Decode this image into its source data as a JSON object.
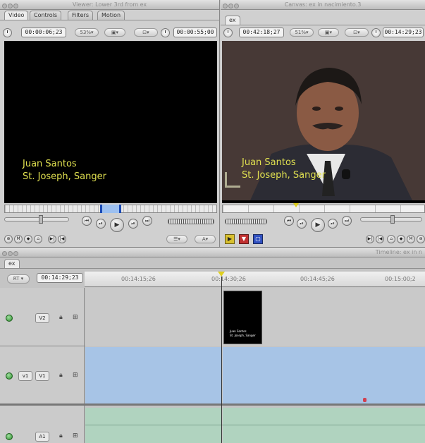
{
  "viewer": {
    "title": "Viewer: Lower 3rd from ex",
    "tabs": [
      "Video",
      "Controls",
      "Filters",
      "Motion"
    ],
    "timecode_left": "00:00:06;23",
    "zoom": "53%",
    "timecode_right": "00:00:55;00",
    "overlay_line1": "Juan Santos",
    "overlay_line2": "St. Joseph, Sanger"
  },
  "canvas": {
    "title": "Canvas: ex in nacimiento.3",
    "tab": "ex",
    "timecode_left": "00:42:18;27",
    "zoom": "51%",
    "timecode_right": "00:14:29;23",
    "overlay_line1": "Juan Santos",
    "overlay_line2": "St. Joseph, Sanger"
  },
  "timeline": {
    "title": "Timeline: ex in n",
    "tab": "ex",
    "rt_label": "RT",
    "current_timecode": "00:14:29;23",
    "ruler_ticks": [
      "00:14:15;26",
      "00:14:30;26",
      "00:14:45;26",
      "00:15:00;2"
    ],
    "tracks": [
      {
        "source": "",
        "dest": "V2"
      },
      {
        "source": "v1",
        "dest": "V1"
      },
      {
        "source": "",
        "dest": "A1"
      }
    ],
    "thumb_line1": "Juan Santos",
    "thumb_line2": "St. Joseph, Sanger"
  },
  "colors": {
    "overlay_text": "#e0e050",
    "video_track_clip": "#a7c4e6",
    "audio_track_clip": "#b0d3bf",
    "playhead": "#e0d020"
  }
}
